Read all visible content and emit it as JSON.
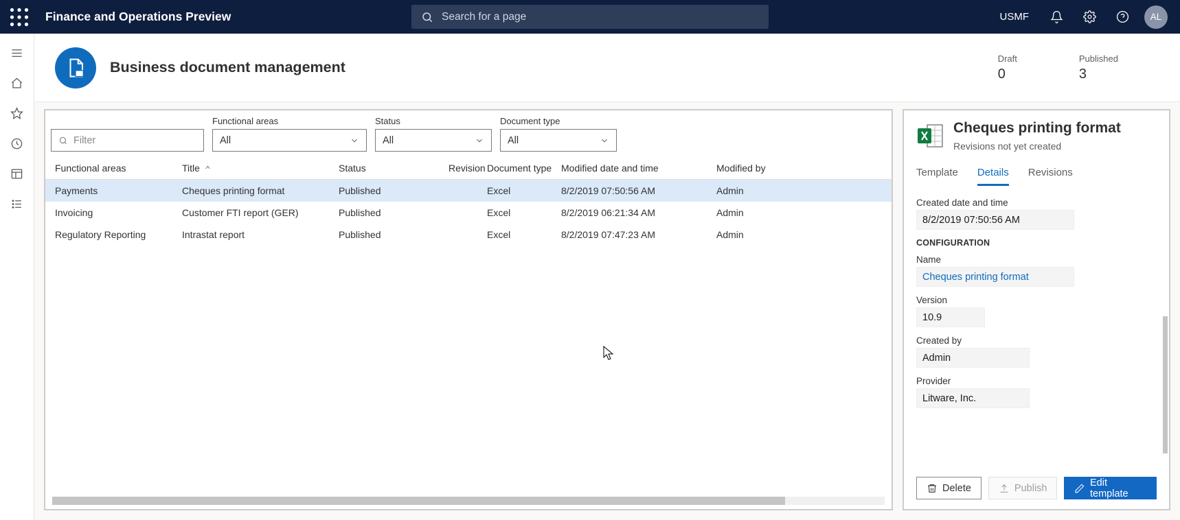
{
  "topbar": {
    "app_title": "Finance and Operations Preview",
    "search_placeholder": "Search for a page",
    "company": "USMF",
    "avatar_initials": "AL"
  },
  "page": {
    "title": "Business document management",
    "counters": {
      "draft_label": "Draft",
      "draft_val": "0",
      "published_label": "Published",
      "published_val": "3"
    }
  },
  "filters": {
    "filter_placeholder": "Filter",
    "fa_label": "Functional areas",
    "fa_value": "All",
    "status_label": "Status",
    "status_value": "All",
    "doctype_label": "Document type",
    "doctype_value": "All"
  },
  "grid": {
    "headers": {
      "fa": "Functional areas",
      "title": "Title",
      "status": "Status",
      "revision": "Revision",
      "doctype": "Document type",
      "modified": "Modified date and time",
      "by": "Modified by"
    },
    "rows": [
      {
        "fa": "Payments",
        "title": "Cheques printing format",
        "status": "Published",
        "rev": "",
        "doctype": "Excel",
        "mod": "8/2/2019 07:50:56 AM",
        "by": "Admin"
      },
      {
        "fa": "Invoicing",
        "title": "Customer FTI report (GER)",
        "status": "Published",
        "rev": "",
        "doctype": "Excel",
        "mod": "8/2/2019 06:21:34 AM",
        "by": "Admin"
      },
      {
        "fa": "Regulatory Reporting",
        "title": "Intrastat report",
        "status": "Published",
        "rev": "",
        "doctype": "Excel",
        "mod": "8/2/2019 07:47:23 AM",
        "by": "Admin"
      }
    ]
  },
  "details": {
    "title": "Cheques printing format",
    "subtitle": "Revisions not yet created",
    "tabs": {
      "template": "Template",
      "details": "Details",
      "revisions": "Revisions"
    },
    "created_label": "Created date and time",
    "created_val": "8/2/2019 07:50:56 AM",
    "section": "CONFIGURATION",
    "name_label": "Name",
    "name_val": "Cheques printing format",
    "version_label": "Version",
    "version_val": "10.9",
    "createdby_label": "Created by",
    "createdby_val": "Admin",
    "provider_label": "Provider",
    "provider_val": "Litware, Inc.",
    "buttons": {
      "delete": "Delete",
      "publish": "Publish",
      "edit": "Edit template"
    }
  }
}
